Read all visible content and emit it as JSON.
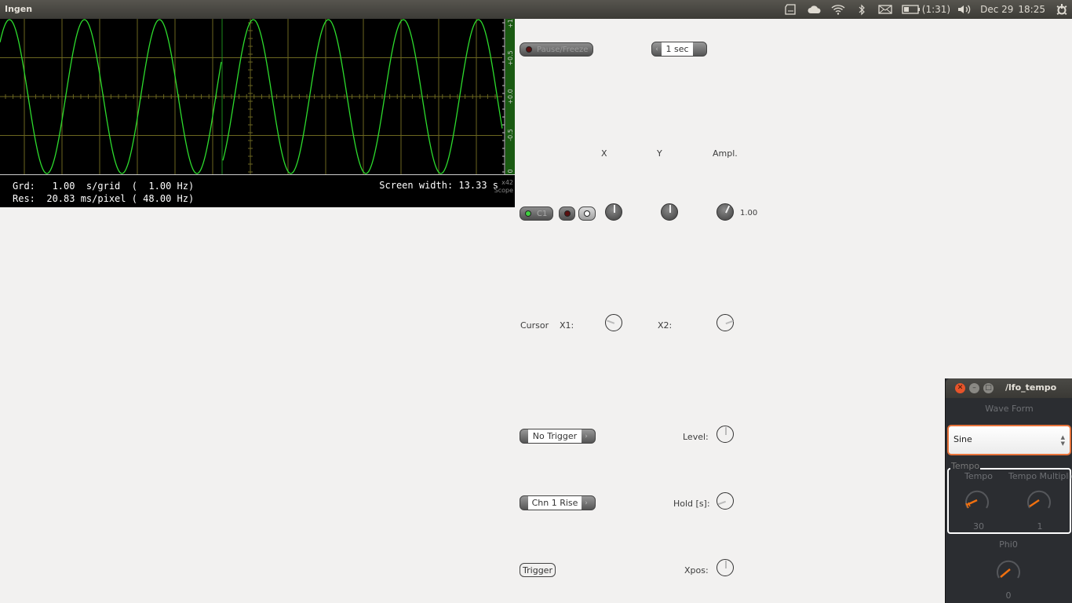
{
  "topbar": {
    "app_title": "Ingen",
    "battery_time": "(1:31)",
    "date": "Dec 29",
    "time": "18:25",
    "icons": [
      "sd-card-icon",
      "cloud-icon",
      "wifi-icon",
      "bluetooth-icon",
      "mail-icon",
      "battery-icon",
      "volume-icon",
      "power-gear-icon"
    ]
  },
  "scope": {
    "grid_line": "Grd:   1.00  s/grid  (  1.00 Hz)",
    "res_line": "Res:  20.83 ms/pixel ( 48.00 Hz)",
    "screen_width": "Screen width: 13.33 s",
    "badge_top": "x42",
    "badge_bottom": "Scope",
    "y_ticks": [
      "+1",
      "+0.5",
      "+0.0",
      "-0.5",
      "0"
    ],
    "trace_color": "#2ddc2d",
    "grid_color": "#6b6620",
    "waveform": {
      "type": "sine",
      "amplitude": 1.0,
      "frequency_hz": 1.0,
      "write_head_fraction": 0.44
    }
  },
  "controls": {
    "pause_label": "Pause/Freeze",
    "timescale_value": "1 sec",
    "col_x": "X",
    "col_y": "Y",
    "col_ampl": "Ampl.",
    "channel_label": "C1",
    "ampl_value": "1.00",
    "cursor_label": "Cursor",
    "x1_label": "X1:",
    "x2_label": "X2:",
    "trigger_mode": "No Trigger",
    "level_label": "Level:",
    "trigger_source": "Chn 1 Rise",
    "hold_label": "Hold [s]:",
    "trigger_button": "Trigger",
    "xpos_label": "Xpos:"
  },
  "lfo_window": {
    "title": "/lfo_tempo",
    "waveform_label": "Wave Form",
    "waveform_value": "Sine",
    "group_label": "Tempo",
    "tempo_label": "Tempo",
    "tempo_value": "30",
    "multiplier_label": "Tempo Multiplie",
    "multiplier_value": "1",
    "phi_label": "Phi0",
    "phi_value": "0",
    "accent": "#f07010"
  }
}
